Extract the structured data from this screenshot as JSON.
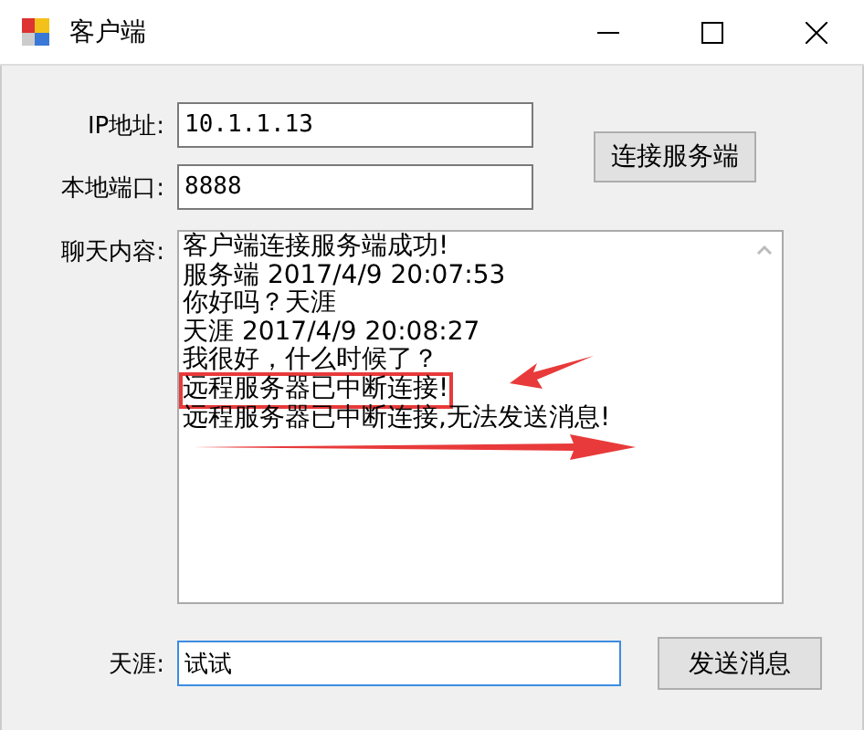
{
  "window": {
    "title": "客户端"
  },
  "form": {
    "ip_label": "IP地址:",
    "ip_value": "10.1.1.13",
    "port_label": "本地端口:",
    "port_value": "8888",
    "connect_button": "连接服务端",
    "chat_label": "聊天内容:",
    "chat_lines": [
      {
        "text": "客户端连接服务端成功!",
        "highlighted": false,
        "arrow_below": false
      },
      {
        "text": "服务端 2017/4/9 20:07:53",
        "highlighted": false,
        "arrow_below": false
      },
      {
        "text": "你好吗？天涯",
        "highlighted": false,
        "arrow_below": false
      },
      {
        "text": "天涯 2017/4/9 20:08:27",
        "highlighted": false,
        "arrow_below": false
      },
      {
        "text": "我很好，什么时候了？",
        "highlighted": false,
        "arrow_below": false
      },
      {
        "text": "远程服务器已中断连接!",
        "highlighted": true,
        "arrow_below": false
      },
      {
        "text": "远程服务器已中断连接,无法发送消息!",
        "highlighted": false,
        "arrow_below": true
      }
    ],
    "name_label": "天涯:",
    "message_value": "试试",
    "send_button": "发送消息"
  }
}
